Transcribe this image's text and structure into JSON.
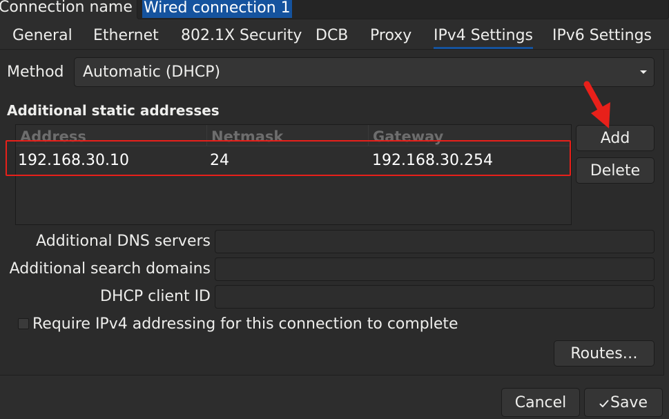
{
  "header": {
    "connection_name_label": "Connection name",
    "connection_name_value": "Wired connection 1"
  },
  "tabs": [
    {
      "label": "General",
      "active": false
    },
    {
      "label": "Ethernet",
      "active": false
    },
    {
      "label": "802.1X Security",
      "active": false
    },
    {
      "label": "DCB",
      "active": false
    },
    {
      "label": "Proxy",
      "active": false
    },
    {
      "label": "IPv4 Settings",
      "active": true
    },
    {
      "label": "IPv6 Settings",
      "active": false
    }
  ],
  "ipv4": {
    "method_label": "Method",
    "method_value": "Automatic (DHCP)",
    "static_section_title": "Additional static addresses",
    "table": {
      "columns": [
        "Address",
        "Netmask",
        "Gateway"
      ],
      "rows": [
        [
          "192.168.30.10",
          "24",
          "192.168.30.254"
        ]
      ]
    },
    "add_button": "Add",
    "delete_button": "Delete",
    "dns_label": "Additional DNS servers",
    "dns_value": "",
    "search_domains_label": "Additional search domains",
    "search_domains_value": "",
    "dhcp_client_id_label": "DHCP client ID",
    "dhcp_client_id_value": "",
    "require_ipv4_label": "Require IPv4 addressing for this connection to complete",
    "require_ipv4_checked": false,
    "routes_button": "Routes…"
  },
  "footer": {
    "cancel_button": "Cancel",
    "save_button": "Save",
    "save_icon": "check-icon"
  },
  "colors": {
    "background": "#2d2d2d",
    "accent": "#15539e",
    "annotation": "#e8201a"
  }
}
